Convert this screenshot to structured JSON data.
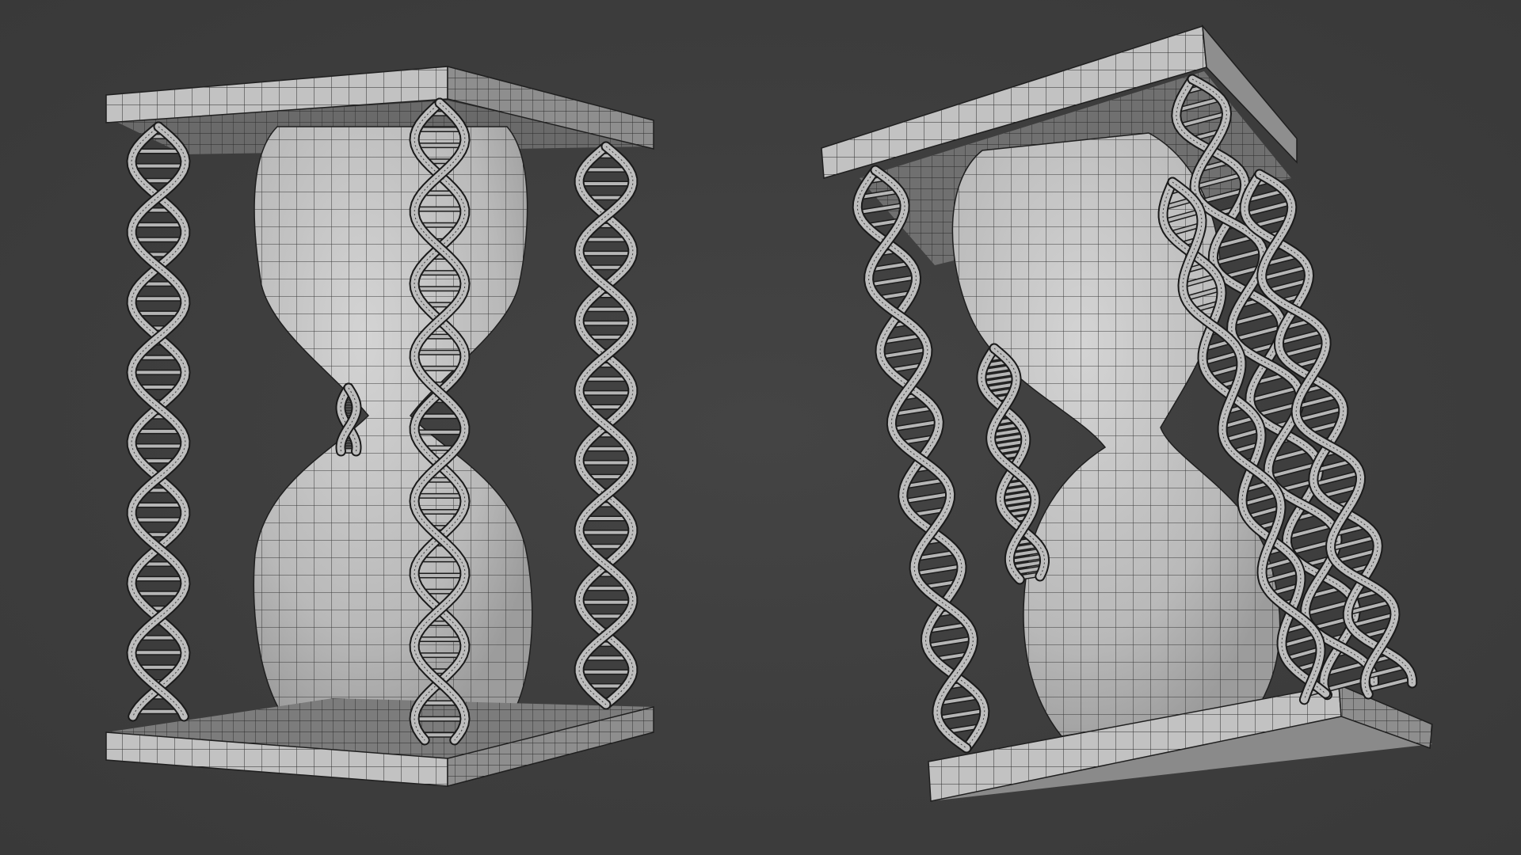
{
  "scene": {
    "background_color": "#3d3d3d",
    "mesh_color": "#c9c9c9",
    "wire_color": "#1a1a1a",
    "objects": [
      {
        "name": "hourglass-front-view",
        "description_icon": "hourglass-dna-icon"
      },
      {
        "name": "hourglass-tilted-view",
        "description_icon": "hourglass-dna-icon"
      }
    ]
  }
}
